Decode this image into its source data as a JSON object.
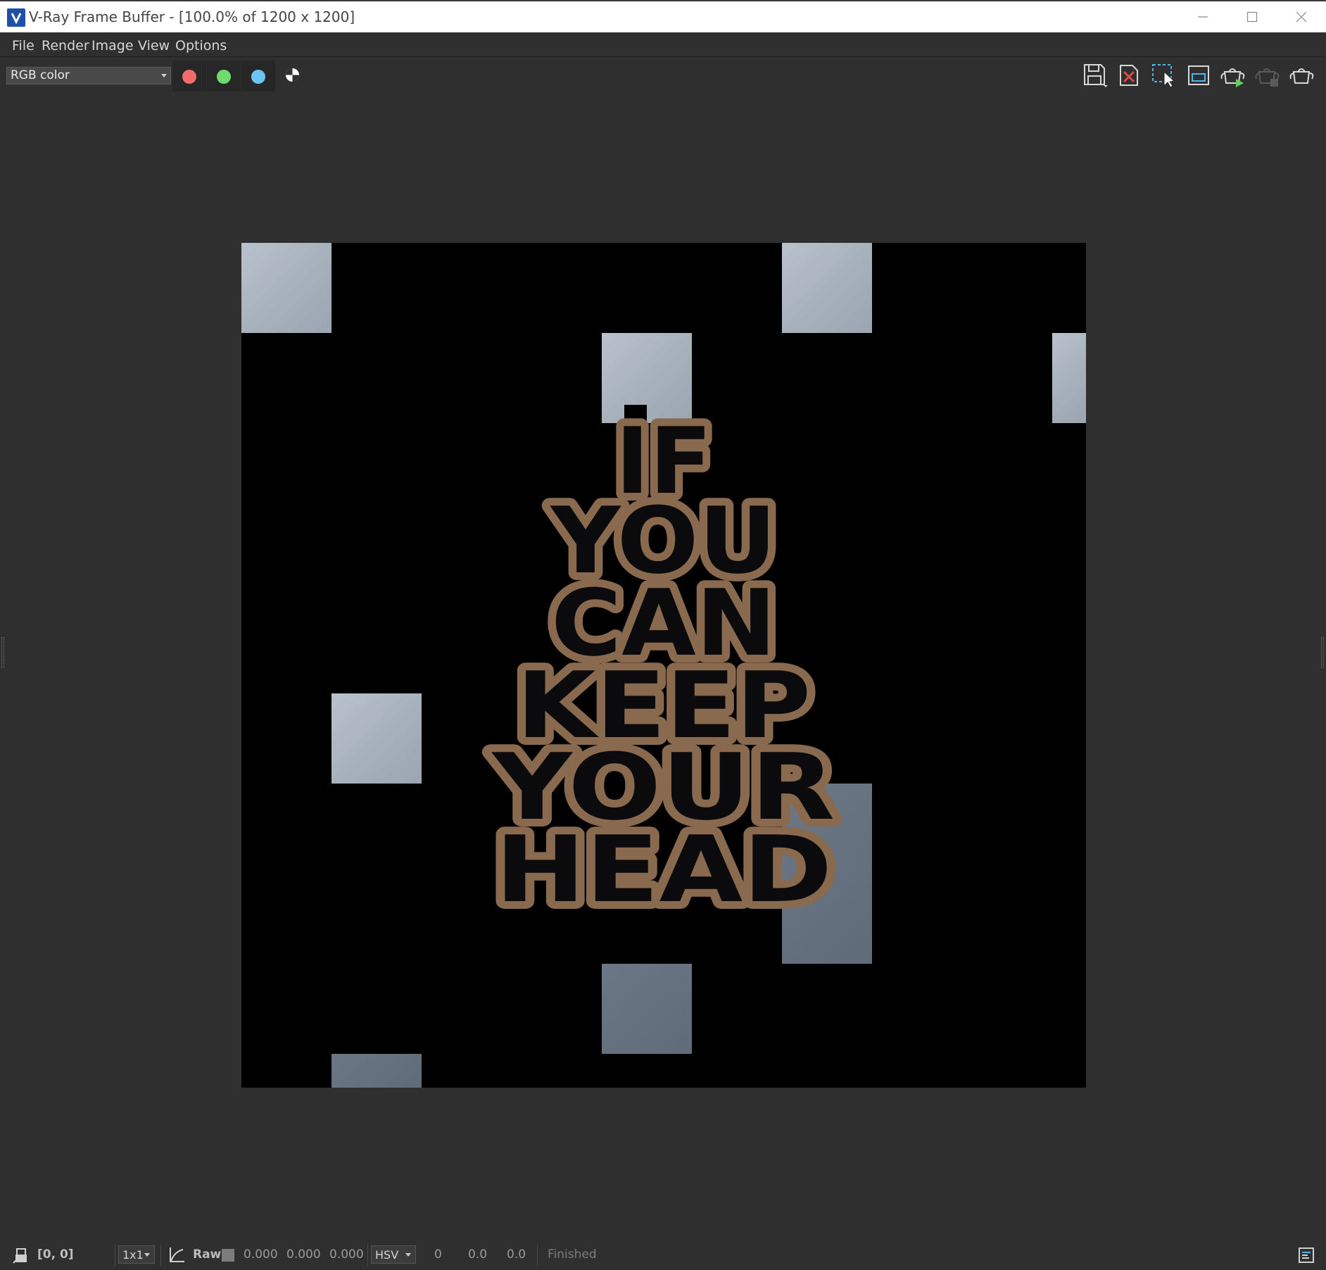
{
  "window": {
    "title": "V-Ray Frame Buffer - [100.0% of 1200 x 1200]"
  },
  "menu": {
    "items": [
      "File",
      "Render",
      "Image",
      "View",
      "Options"
    ]
  },
  "toolbar": {
    "channel": "RGB color",
    "channel_buttons": [
      {
        "name": "red-channel",
        "color": "#f26c6c"
      },
      {
        "name": "green-channel",
        "color": "#6ddc6d"
      },
      {
        "name": "blue-channel",
        "color": "#6cc4f2"
      }
    ],
    "icons": [
      "save-icon",
      "clear-image-icon",
      "region-select-icon",
      "track-mouse-icon",
      "render-teapot-icon",
      "stop-render-teapot-icon",
      "render-last-teapot-icon"
    ]
  },
  "render": {
    "text_lines": [
      "IF",
      "YOU",
      "CAN",
      "KEEP",
      "YOUR",
      "HEAD"
    ],
    "text_color": "#8a6a4e"
  },
  "statusbar": {
    "coords": "[0, 0]",
    "zoom": "1x1",
    "mode": "Raw",
    "r": "0.000",
    "g": "0.000",
    "b": "0.000",
    "color_space": "HSV",
    "h": "0",
    "s": "0.0",
    "v": "0.0",
    "status": "Finished"
  }
}
